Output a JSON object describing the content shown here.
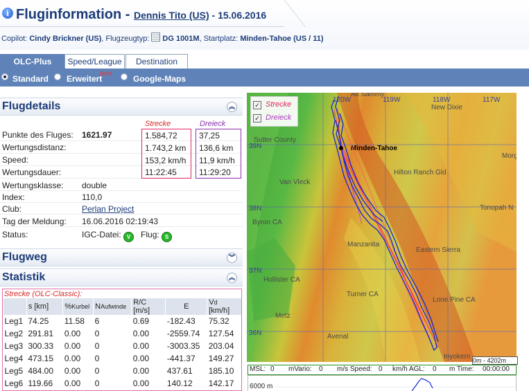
{
  "header": {
    "title": "Fluginformation",
    "pilot": "Dennis Tito (US)",
    "date_sep": " - ",
    "date": "15.06.2016",
    "copilot_label": "Copilot:",
    "copilot": "Cindy Brickner (US)",
    "type_label": "Flugzeugtyp:",
    "type": "DG 1001M",
    "start_label": "Startplatz:",
    "start": "Minden-Tahoe (US / 11)"
  },
  "tabs": [
    {
      "label": "OLC-Plus",
      "active": true
    },
    {
      "label": "Speed/League",
      "active": false
    },
    {
      "label": "Destination",
      "active": false
    }
  ],
  "views": {
    "standard": "Standard",
    "extended": "Erweitert",
    "beta": "beta",
    "google": "Google-Maps",
    "selected": "standard"
  },
  "flugdetails": {
    "title": "Flugdetails",
    "col_strecke": "Strecke",
    "col_dreieck": "Dreieck",
    "rows": [
      {
        "label": "Punkte des Fluges:",
        "value": "1621.97",
        "strecke": "1.584,72",
        "dreieck": "37,25"
      },
      {
        "label": "Wertungsdistanz:",
        "value": "",
        "strecke": "1.743,2 km",
        "dreieck": "136,6 km"
      },
      {
        "label": "Speed:",
        "value": "",
        "strecke": "153,2 km/h",
        "dreieck": "11,9 km/h"
      },
      {
        "label": "Wertungsdauer:",
        "value": "",
        "strecke": "11:22:45",
        "dreieck": "11:29:20"
      },
      {
        "label": "Wertungsklasse:",
        "value": "double"
      },
      {
        "label": "Index:",
        "value": "110,0"
      },
      {
        "label": "Club:",
        "value": "Perlan Project"
      },
      {
        "label": "Tag der Meldung:",
        "value": "16.06.2016 02:19:43"
      }
    ],
    "status_label": "Status:",
    "igc_label": "IGC-Datei:",
    "igc_badge": "V",
    "flug_label": "Flug:",
    "flug_badge": "S"
  },
  "flugweg": {
    "title": "Flugweg"
  },
  "statistik": {
    "title": "Statistik",
    "caption": "Strecke (OLC-Classic):",
    "headers": [
      "",
      "s [km]",
      "%Kurbel",
      "NAufwinde",
      "R/C [m/s]",
      "E",
      "Vd [km/h]"
    ],
    "rows": [
      [
        "Leg1",
        "74.25",
        "11.58",
        "6",
        "0.69",
        "-182.43",
        "75.32"
      ],
      [
        "Leg2",
        "291.81",
        "0.00",
        "0",
        "0.00",
        "-2559.74",
        "127.54"
      ],
      [
        "Leg3",
        "300.33",
        "0.00",
        "0",
        "0.00",
        "-3003.35",
        "203.04"
      ],
      [
        "Leg4",
        "473.15",
        "0.00",
        "0",
        "0.00",
        "-441.37",
        "149.27"
      ],
      [
        "Leg5",
        "484.00",
        "0.00",
        "0",
        "0.00",
        "437.61",
        "185.10"
      ],
      [
        "Leg6",
        "119.66",
        "0.00",
        "0",
        "0.00",
        "140.12",
        "142.17"
      ]
    ]
  },
  "map": {
    "legend": [
      {
        "label": "Strecke",
        "color": "#e0245e",
        "checked": true
      },
      {
        "label": "Dreieck",
        "color": "#b03cc0",
        "checked": true
      }
    ],
    "lon_labels": [
      "120W",
      "119W",
      "118W",
      "117W"
    ],
    "lat_labels": [
      "39N",
      "38N",
      "37N",
      "36N"
    ],
    "places": [
      "Alt Sammy",
      "New Dixie",
      "Sutter County",
      "Minden-Tahoe",
      "Hilton Ranch Gld",
      "Morg",
      "Van Vleck",
      "Tonopah N",
      "Byron CA",
      "Manzanita",
      "Eastern Sierra",
      "Hollister CA",
      "Turner CA",
      "Lone Pine CA",
      "Metz",
      "Avenal",
      "Inyokern"
    ],
    "scale": "0m - 4202m"
  },
  "readout": {
    "msl_label": "MSL:",
    "msl": "0",
    "mvario_label": "mVario:",
    "mvario": "0",
    "speed_label": "m/s Speed:",
    "speed": "0",
    "agl_label": "km/h AGL:",
    "agl": "0",
    "time_label": "m Time:",
    "time": "00:00:00"
  },
  "barogram_label": "6000 m"
}
